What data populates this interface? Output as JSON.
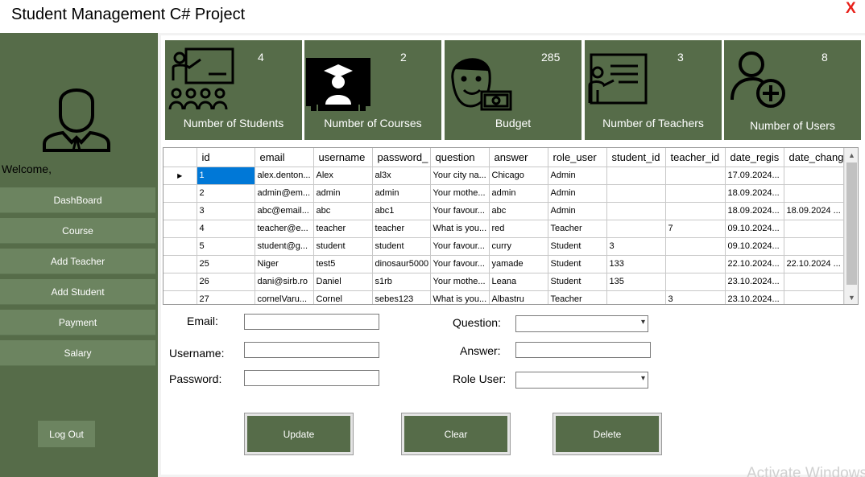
{
  "window": {
    "title": "Student Management C# Project",
    "close_label": "X"
  },
  "sidebar": {
    "welcome": "Welcome,",
    "items": [
      {
        "label": "DashBoard"
      },
      {
        "label": "Course"
      },
      {
        "label": "Add Teacher"
      },
      {
        "label": "Add Student"
      },
      {
        "label": "Payment"
      },
      {
        "label": "Salary"
      }
    ],
    "logout_label": "Log Out"
  },
  "cards": [
    {
      "count": "4",
      "label": "Number of Students",
      "icon": "teacher-classroom-icon"
    },
    {
      "count": "2",
      "label": "Number of Courses",
      "icon": "graduate-screen-icon"
    },
    {
      "count": "285",
      "label": "Budget",
      "icon": "person-money-icon"
    },
    {
      "count": "3",
      "label": "Number of Teachers",
      "icon": "teacher-board-icon"
    },
    {
      "count": "8",
      "label": "Number of Users",
      "icon": "add-user-icon"
    }
  ],
  "grid": {
    "columns": [
      "id",
      "email",
      "username",
      "password_",
      "question",
      "answer",
      "role_user",
      "student_id",
      "teacher_id",
      "date_regis",
      "date_chang"
    ],
    "rows": [
      [
        "1",
        "alex.denton...",
        "Alex",
        "al3x",
        "Your city na...",
        "Chicago",
        "Admin",
        "",
        "",
        "17.09.2024...",
        ""
      ],
      [
        "2",
        "admin@em...",
        "admin",
        "admin",
        "Your mothe...",
        "admin",
        "Admin",
        "",
        "",
        "18.09.2024...",
        ""
      ],
      [
        "3",
        "abc@email...",
        "abc",
        "abc1",
        "Your favour...",
        "abc",
        "Admin",
        "",
        "",
        "18.09.2024...",
        "18.09.2024 ..."
      ],
      [
        "4",
        "teacher@e...",
        "teacher",
        "teacher",
        "What is you...",
        "red",
        "Teacher",
        "",
        "7",
        "09.10.2024...",
        ""
      ],
      [
        "5",
        "student@g...",
        "student",
        "student",
        "Your favour...",
        "curry",
        "Student",
        "3",
        "",
        "09.10.2024...",
        ""
      ],
      [
        "25",
        "Niger",
        "test5",
        "dinosaur5000",
        "Your favour...",
        "yamade",
        "Student",
        "133",
        "",
        "22.10.2024...",
        "22.10.2024 ..."
      ],
      [
        "26",
        "dani@sirb.ro",
        "Daniel",
        "s1rb",
        "Your mothe...",
        "Leana",
        "Student",
        "135",
        "",
        "23.10.2024...",
        ""
      ],
      [
        "27",
        "cornelVaru...",
        "Cornel",
        "sebes123",
        "What is you...",
        "Albastru",
        "Teacher",
        "",
        "3",
        "23.10.2024...",
        ""
      ]
    ],
    "current_row_marker": "▶"
  },
  "form": {
    "email_label": "Email:",
    "username_label": "Username:",
    "password_label": "Password:",
    "question_label": "Question:",
    "answer_label": "Answer:",
    "role_label": "Role User:",
    "email_value": "",
    "username_value": "",
    "password_value": "",
    "answer_value": ""
  },
  "actions": {
    "update": "Update",
    "clear": "Clear",
    "delete": "Delete"
  },
  "watermark": "Activate Windows",
  "colors": {
    "panel": "#566c49",
    "button": "#6c8460",
    "selection": "#0078d7",
    "close": "#e8201a"
  }
}
